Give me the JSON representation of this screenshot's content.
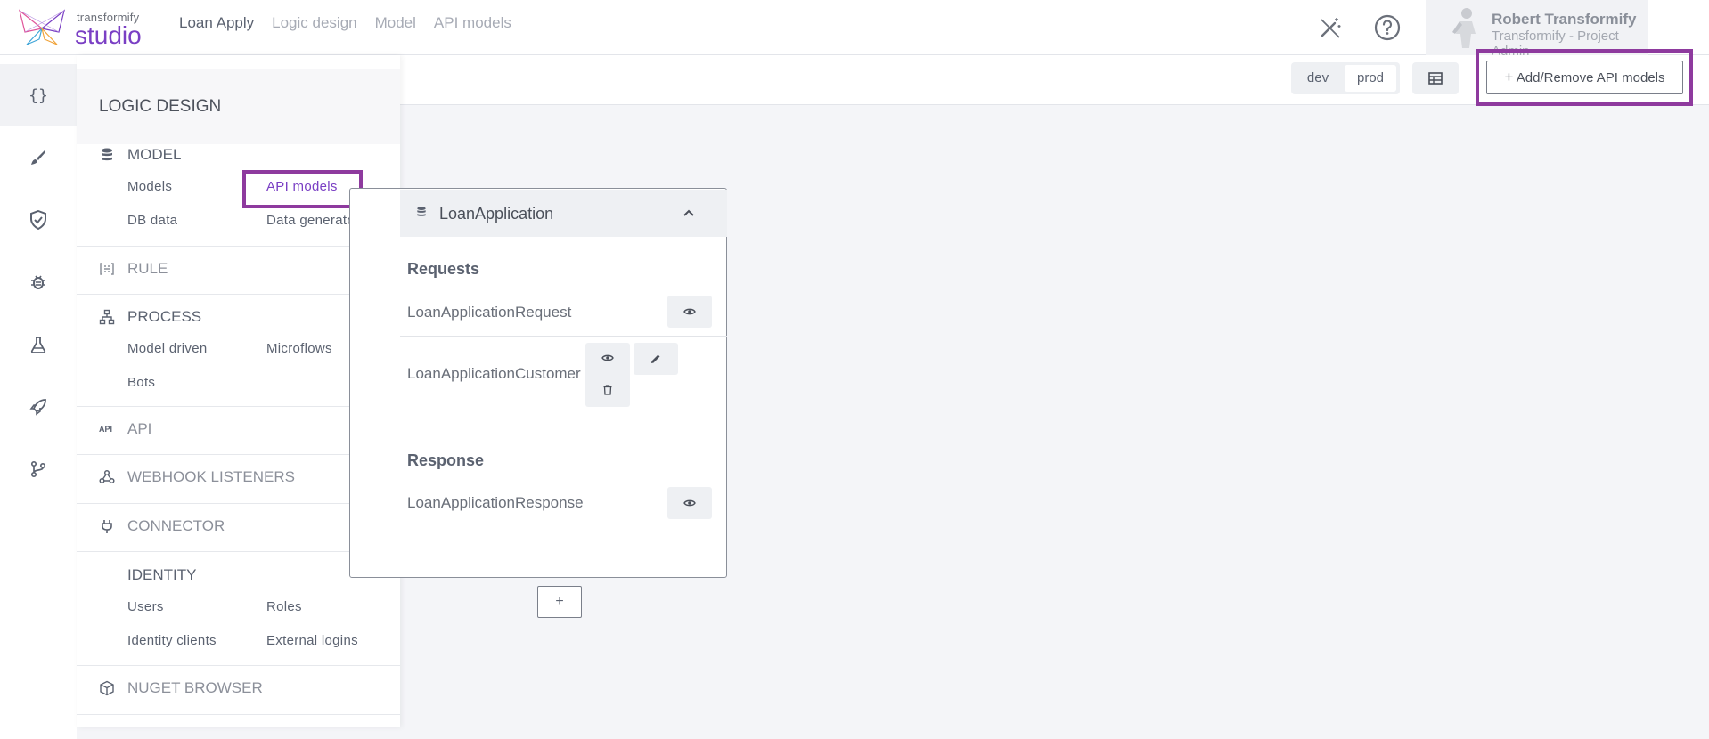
{
  "brand": {
    "top": "transformify",
    "bottom": "studio"
  },
  "nav": [
    {
      "label": "Loan Apply",
      "active": true
    },
    {
      "label": "Logic design",
      "active": false
    },
    {
      "label": "Model",
      "active": false
    },
    {
      "label": "API models",
      "active": false
    }
  ],
  "header_icons": [
    "magic-wand-off-icon",
    "help-icon"
  ],
  "user": {
    "name": "Robert Transformify",
    "role": "Transformify - Project Admin"
  },
  "toolbar": {
    "env": [
      "dev",
      "prod"
    ],
    "env_selected": "prod",
    "grid_icon": "table-icon",
    "add_label": "Add/Remove API models"
  },
  "rail": [
    "code-braces-icon",
    "brush-icon",
    "shield-check-icon",
    "bug-icon",
    "flask-icon",
    "rocket-icon",
    "git-branch-icon"
  ],
  "rail_code_glyph": "{}",
  "menu": {
    "title": "LOGIC DESIGN",
    "model": {
      "label": "MODEL",
      "links": [
        "Models",
        "API models",
        "DB data",
        "Data generators"
      ]
    },
    "rule": "RULE",
    "process": {
      "label": "PROCESS",
      "links": [
        "Model driven",
        "Microflows",
        "Bots"
      ]
    },
    "api": "API",
    "api_badge": "API",
    "webhook": "WEBHOOK LISTENERS",
    "connector": "CONNECTOR",
    "identity": {
      "label": "IDENTITY",
      "links": [
        "Users",
        "Roles",
        "Identity clients",
        "External logins"
      ]
    },
    "nuget": "NUGET BROWSER"
  },
  "card": {
    "title": "LoanApplication",
    "requests_label": "Requests",
    "requests": [
      "LoanApplicationRequest",
      "LoanApplicationCustomer"
    ],
    "response_label": "Response",
    "responses": [
      "LoanApplicationResponse"
    ]
  },
  "add_card_label": "+",
  "colors": {
    "accent": "#7a3fc4",
    "highlight": "#8e3a9e"
  }
}
